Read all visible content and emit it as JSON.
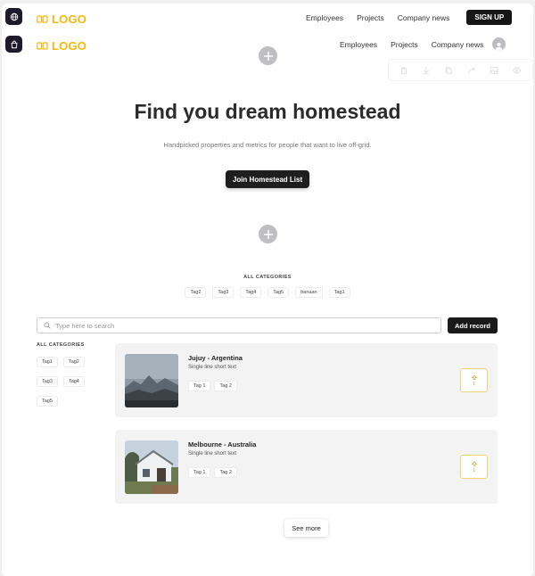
{
  "header_primary": {
    "logo_text": "LOGO",
    "nav": [
      "Employees",
      "Projects",
      "Company news"
    ],
    "signup_label": "SIGN UP"
  },
  "header_secondary": {
    "logo_text": "LOGO",
    "nav": [
      "Employees",
      "Projects",
      "Company news"
    ]
  },
  "hero": {
    "title": "Find you dream homestead",
    "subtitle": "Handpicked properties and metrics for people that want to live off-grid.",
    "cta_label": "Join Homestead List"
  },
  "categories_top": {
    "title": "ALL CATEGORIES",
    "tags": [
      "Tag2",
      "Tag3",
      "Tag4",
      "Tag5",
      "banaan",
      "Tag1"
    ]
  },
  "search": {
    "placeholder": "Type here to search",
    "add_label": "Add record"
  },
  "sidebar_categories": {
    "title": "ALL CATEGORIES",
    "tags": [
      "Tag1",
      "Tag2",
      "Tag3",
      "Tag4",
      "Tag5"
    ]
  },
  "listings": [
    {
      "title": "Jujuy - Argentina",
      "subtitle": "Single line short text",
      "tags": [
        "Tag 1",
        "Tag 2"
      ],
      "votes": "1"
    },
    {
      "title": "Melbourne - Australia",
      "subtitle": "Single line short text",
      "tags": [
        "Tag 1",
        "Tag 2"
      ],
      "votes": "1"
    }
  ],
  "see_more_label": "See more",
  "colors": {
    "brand": "#f5b80d",
    "dark": "#1a1a1a",
    "vote_border": "#f0d27a"
  },
  "icons": {
    "side_buttons": [
      "globe-icon",
      "shopping-bag-icon"
    ],
    "toolbar": [
      "trash-icon",
      "download-icon",
      "copy-icon",
      "share-icon",
      "image-icon",
      "eye-icon"
    ],
    "search": "search-icon",
    "vote": "arrow-up-icon"
  }
}
